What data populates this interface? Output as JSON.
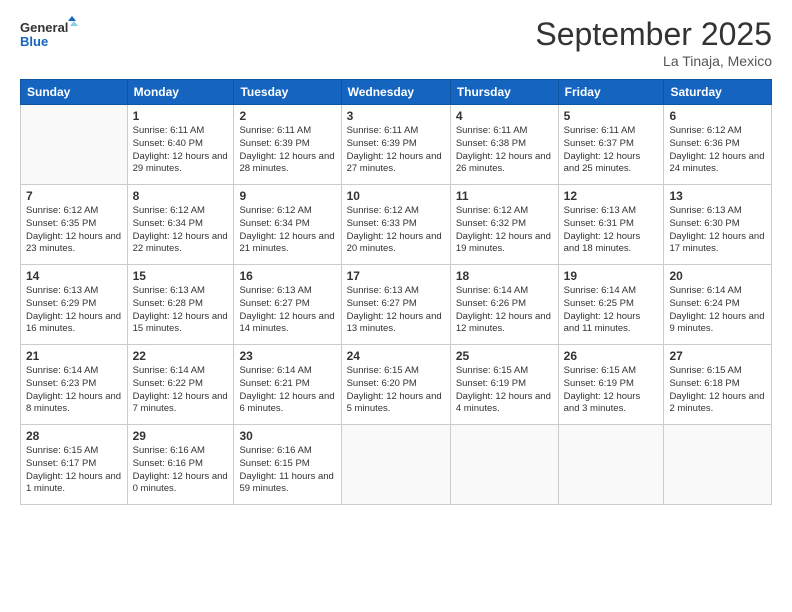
{
  "logo": {
    "line1": "General",
    "line2": "Blue"
  },
  "title": "September 2025",
  "subtitle": "La Tinaja, Mexico",
  "days_header": [
    "Sunday",
    "Monday",
    "Tuesday",
    "Wednesday",
    "Thursday",
    "Friday",
    "Saturday"
  ],
  "weeks": [
    [
      {
        "day": "",
        "info": ""
      },
      {
        "day": "1",
        "info": "Sunrise: 6:11 AM\nSunset: 6:40 PM\nDaylight: 12 hours\nand 29 minutes."
      },
      {
        "day": "2",
        "info": "Sunrise: 6:11 AM\nSunset: 6:39 PM\nDaylight: 12 hours\nand 28 minutes."
      },
      {
        "day": "3",
        "info": "Sunrise: 6:11 AM\nSunset: 6:39 PM\nDaylight: 12 hours\nand 27 minutes."
      },
      {
        "day": "4",
        "info": "Sunrise: 6:11 AM\nSunset: 6:38 PM\nDaylight: 12 hours\nand 26 minutes."
      },
      {
        "day": "5",
        "info": "Sunrise: 6:11 AM\nSunset: 6:37 PM\nDaylight: 12 hours\nand 25 minutes."
      },
      {
        "day": "6",
        "info": "Sunrise: 6:12 AM\nSunset: 6:36 PM\nDaylight: 12 hours\nand 24 minutes."
      }
    ],
    [
      {
        "day": "7",
        "info": "Sunrise: 6:12 AM\nSunset: 6:35 PM\nDaylight: 12 hours\nand 23 minutes."
      },
      {
        "day": "8",
        "info": "Sunrise: 6:12 AM\nSunset: 6:34 PM\nDaylight: 12 hours\nand 22 minutes."
      },
      {
        "day": "9",
        "info": "Sunrise: 6:12 AM\nSunset: 6:34 PM\nDaylight: 12 hours\nand 21 minutes."
      },
      {
        "day": "10",
        "info": "Sunrise: 6:12 AM\nSunset: 6:33 PM\nDaylight: 12 hours\nand 20 minutes."
      },
      {
        "day": "11",
        "info": "Sunrise: 6:12 AM\nSunset: 6:32 PM\nDaylight: 12 hours\nand 19 minutes."
      },
      {
        "day": "12",
        "info": "Sunrise: 6:13 AM\nSunset: 6:31 PM\nDaylight: 12 hours\nand 18 minutes."
      },
      {
        "day": "13",
        "info": "Sunrise: 6:13 AM\nSunset: 6:30 PM\nDaylight: 12 hours\nand 17 minutes."
      }
    ],
    [
      {
        "day": "14",
        "info": "Sunrise: 6:13 AM\nSunset: 6:29 PM\nDaylight: 12 hours\nand 16 minutes."
      },
      {
        "day": "15",
        "info": "Sunrise: 6:13 AM\nSunset: 6:28 PM\nDaylight: 12 hours\nand 15 minutes."
      },
      {
        "day": "16",
        "info": "Sunrise: 6:13 AM\nSunset: 6:27 PM\nDaylight: 12 hours\nand 14 minutes."
      },
      {
        "day": "17",
        "info": "Sunrise: 6:13 AM\nSunset: 6:27 PM\nDaylight: 12 hours\nand 13 minutes."
      },
      {
        "day": "18",
        "info": "Sunrise: 6:14 AM\nSunset: 6:26 PM\nDaylight: 12 hours\nand 12 minutes."
      },
      {
        "day": "19",
        "info": "Sunrise: 6:14 AM\nSunset: 6:25 PM\nDaylight: 12 hours\nand 11 minutes."
      },
      {
        "day": "20",
        "info": "Sunrise: 6:14 AM\nSunset: 6:24 PM\nDaylight: 12 hours\nand 9 minutes."
      }
    ],
    [
      {
        "day": "21",
        "info": "Sunrise: 6:14 AM\nSunset: 6:23 PM\nDaylight: 12 hours\nand 8 minutes."
      },
      {
        "day": "22",
        "info": "Sunrise: 6:14 AM\nSunset: 6:22 PM\nDaylight: 12 hours\nand 7 minutes."
      },
      {
        "day": "23",
        "info": "Sunrise: 6:14 AM\nSunset: 6:21 PM\nDaylight: 12 hours\nand 6 minutes."
      },
      {
        "day": "24",
        "info": "Sunrise: 6:15 AM\nSunset: 6:20 PM\nDaylight: 12 hours\nand 5 minutes."
      },
      {
        "day": "25",
        "info": "Sunrise: 6:15 AM\nSunset: 6:19 PM\nDaylight: 12 hours\nand 4 minutes."
      },
      {
        "day": "26",
        "info": "Sunrise: 6:15 AM\nSunset: 6:19 PM\nDaylight: 12 hours\nand 3 minutes."
      },
      {
        "day": "27",
        "info": "Sunrise: 6:15 AM\nSunset: 6:18 PM\nDaylight: 12 hours\nand 2 minutes."
      }
    ],
    [
      {
        "day": "28",
        "info": "Sunrise: 6:15 AM\nSunset: 6:17 PM\nDaylight: 12 hours\nand 1 minute."
      },
      {
        "day": "29",
        "info": "Sunrise: 6:16 AM\nSunset: 6:16 PM\nDaylight: 12 hours\nand 0 minutes."
      },
      {
        "day": "30",
        "info": "Sunrise: 6:16 AM\nSunset: 6:15 PM\nDaylight: 11 hours\nand 59 minutes."
      },
      {
        "day": "",
        "info": ""
      },
      {
        "day": "",
        "info": ""
      },
      {
        "day": "",
        "info": ""
      },
      {
        "day": "",
        "info": ""
      }
    ]
  ]
}
